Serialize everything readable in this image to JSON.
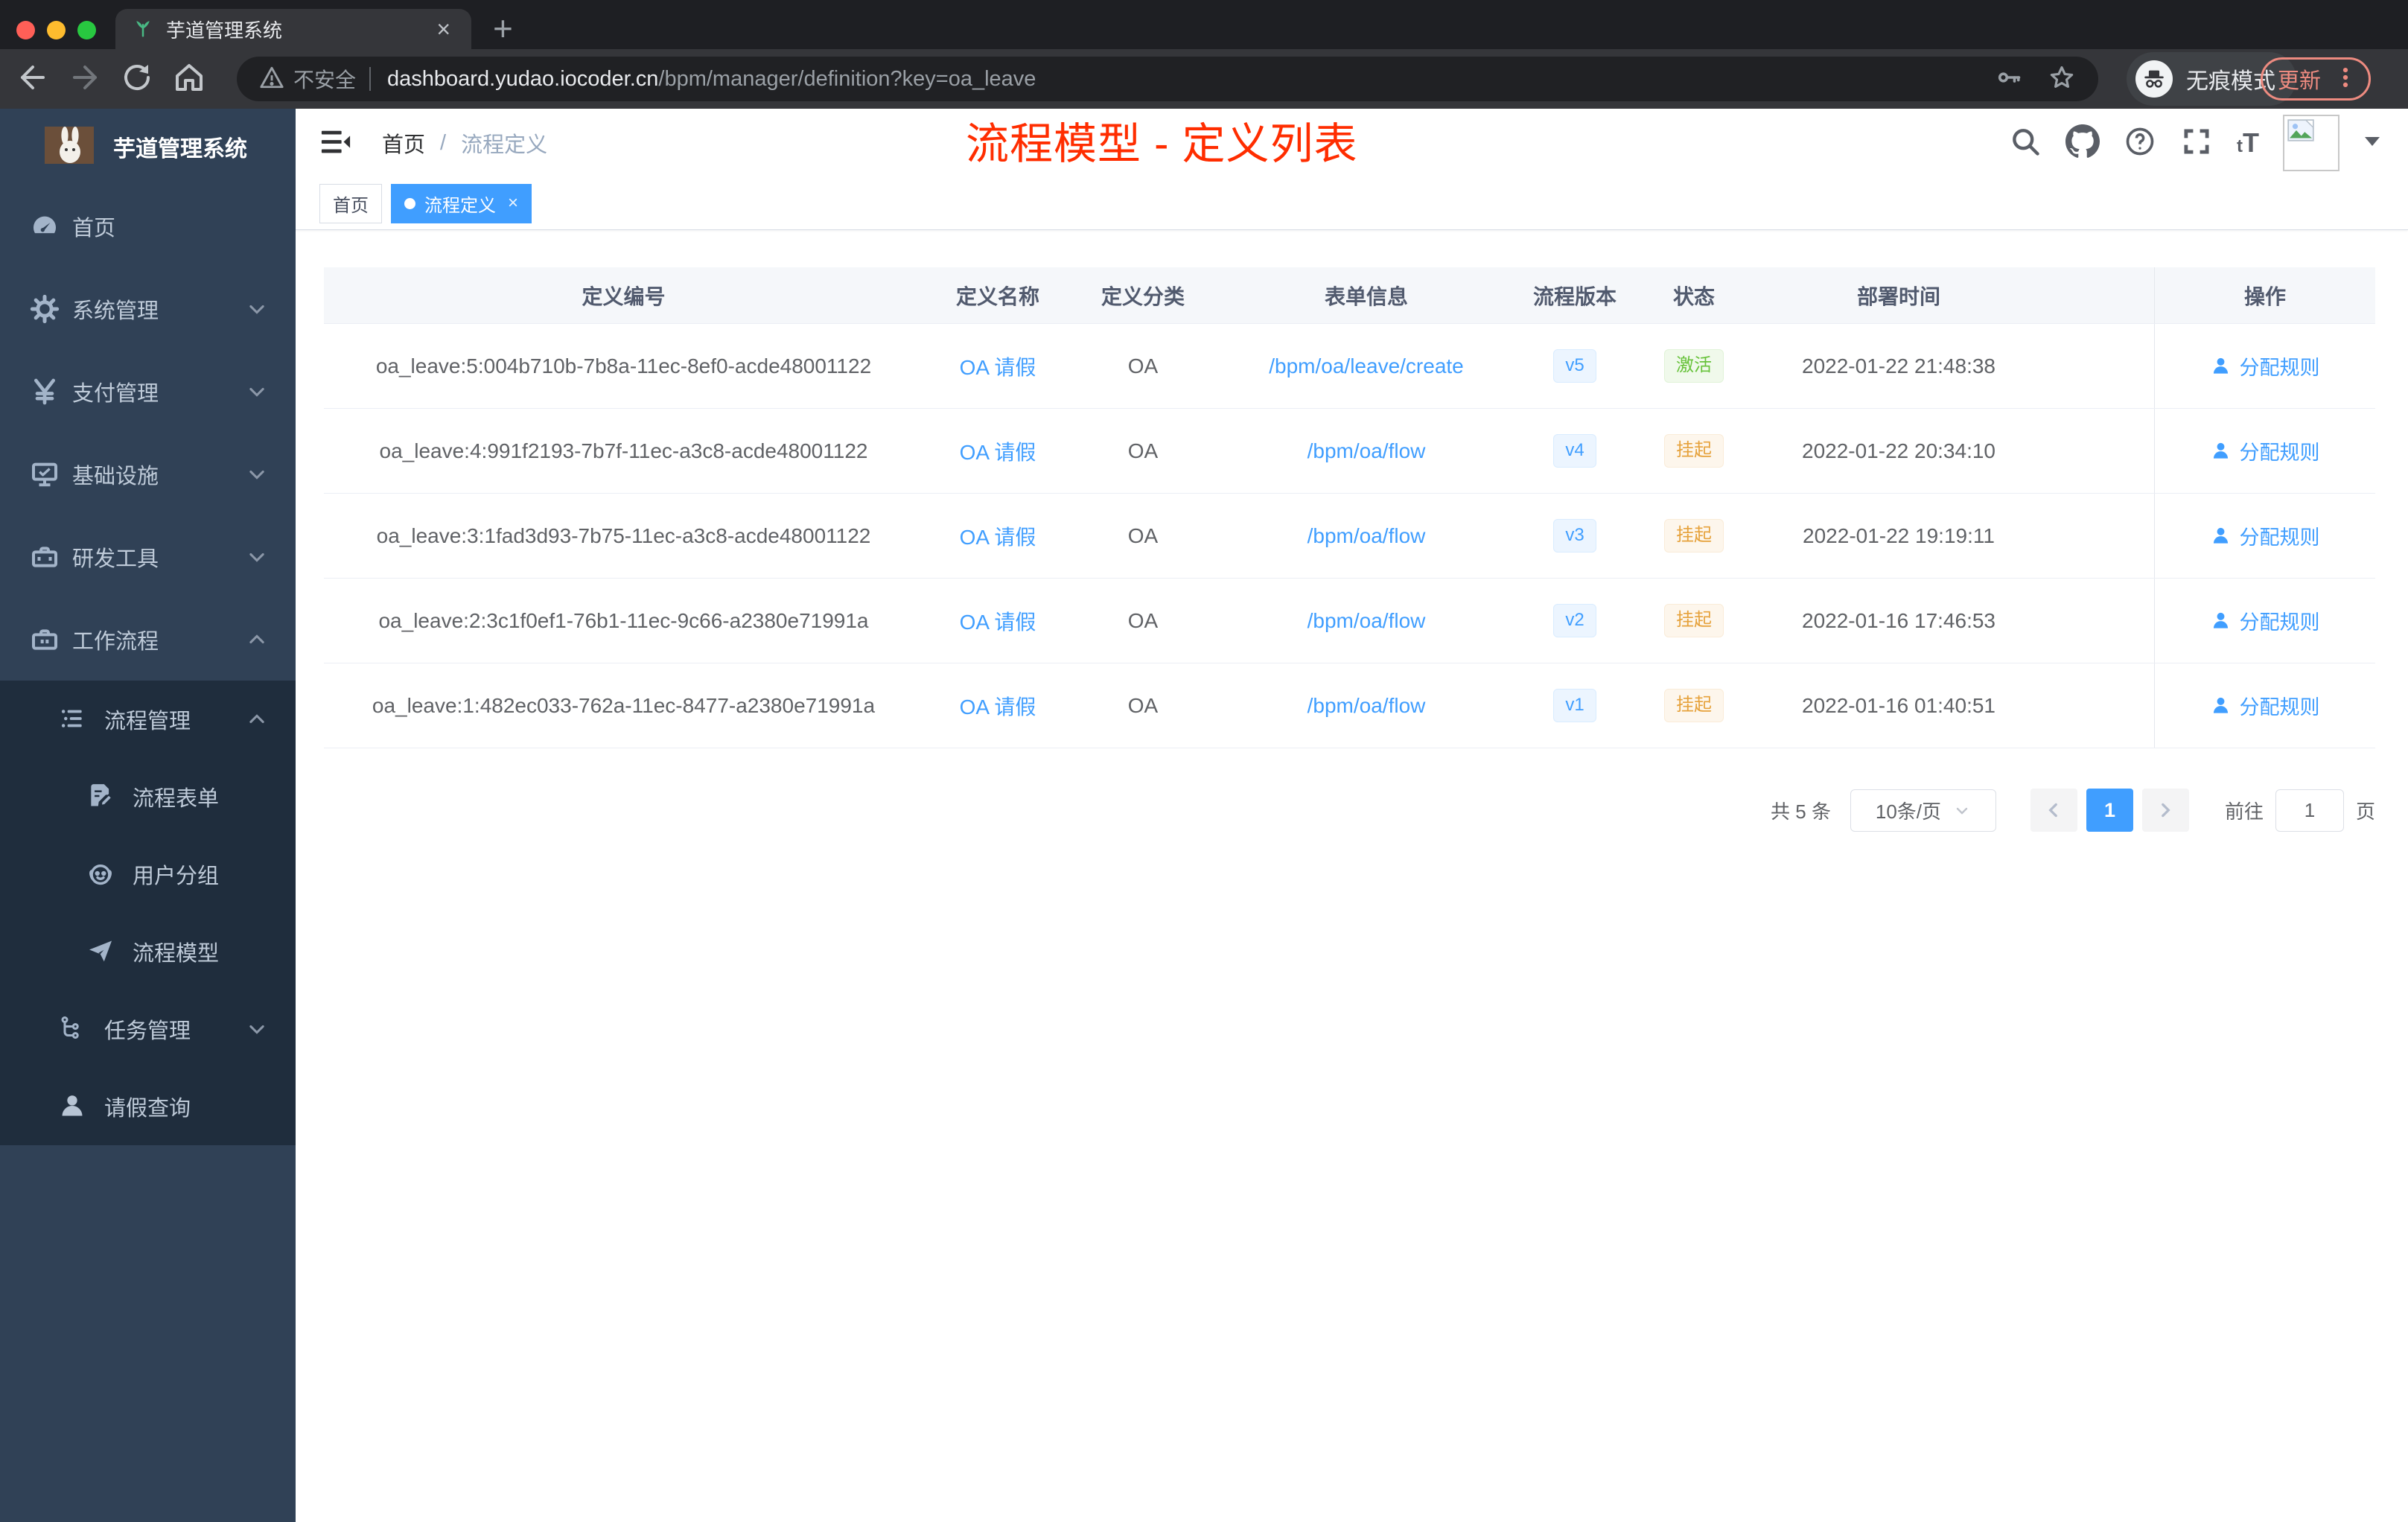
{
  "browser": {
    "tab_title": "芋道管理系统",
    "security_label": "不安全",
    "url_host": "dashboard.yudao.iocoder.cn",
    "url_path": "/bpm/manager/definition?key=oa_leave",
    "incognito_label": "无痕模式",
    "update_label": "更新"
  },
  "sidebar": {
    "app_title": "芋道管理系统",
    "items": [
      {
        "label": "首页",
        "icon": "dashboard-icon",
        "level": 0,
        "chevron": null,
        "expanded": false
      },
      {
        "label": "系统管理",
        "icon": "gear-icon",
        "level": 0,
        "chevron": "down",
        "expanded": false
      },
      {
        "label": "支付管理",
        "icon": "yen-icon",
        "level": 0,
        "chevron": "down",
        "expanded": false
      },
      {
        "label": "基础设施",
        "icon": "monitor-icon",
        "level": 0,
        "chevron": "down",
        "expanded": false
      },
      {
        "label": "研发工具",
        "icon": "toolbox-icon",
        "level": 0,
        "chevron": "down",
        "expanded": false
      },
      {
        "label": "工作流程",
        "icon": "briefcase-icon",
        "level": 0,
        "chevron": "up",
        "expanded": true
      },
      {
        "label": "流程管理",
        "icon": "list-icon",
        "level": 1,
        "chevron": "up",
        "expanded": true
      },
      {
        "label": "流程表单",
        "icon": "form-icon",
        "level": 2,
        "chevron": null,
        "expanded": false
      },
      {
        "label": "用户分组",
        "icon": "robot-icon",
        "level": 2,
        "chevron": null,
        "expanded": false
      },
      {
        "label": "流程模型",
        "icon": "send-icon",
        "level": 2,
        "chevron": null,
        "expanded": false
      },
      {
        "label": "任务管理",
        "icon": "tree-icon",
        "level": 1,
        "chevron": "down",
        "expanded": false
      },
      {
        "label": "请假查询",
        "icon": "user-icon",
        "level": 1,
        "chevron": null,
        "expanded": false
      }
    ]
  },
  "navbar": {
    "breadcrumb_home": "首页",
    "breadcrumb_sep": "/",
    "breadcrumb_current": "流程定义",
    "fontsize_small": "t",
    "fontsize_big": "T"
  },
  "annotation": {
    "text": "流程模型 - 定义列表",
    "color": "#ff2d00"
  },
  "tags": {
    "items": [
      {
        "label": "首页",
        "active": false
      },
      {
        "label": "流程定义",
        "active": true,
        "close": "×"
      }
    ]
  },
  "table": {
    "columns": [
      "定义编号",
      "定义名称",
      "定义分类",
      "表单信息",
      "流程版本",
      "状态",
      "部署时间",
      "操作"
    ],
    "rows": [
      {
        "id": "oa_leave:5:004b710b-7b8a-11ec-8ef0-acde48001122",
        "name": "OA 请假",
        "category": "OA",
        "form": "/bpm/oa/leave/create",
        "version": "v5",
        "status": "激活",
        "status_type": "success",
        "time": "2022-01-22 21:48:38",
        "action": "分配规则"
      },
      {
        "id": "oa_leave:4:991f2193-7b7f-11ec-a3c8-acde48001122",
        "name": "OA 请假",
        "category": "OA",
        "form": "/bpm/oa/flow",
        "version": "v4",
        "status": "挂起",
        "status_type": "warning",
        "time": "2022-01-22 20:34:10",
        "action": "分配规则"
      },
      {
        "id": "oa_leave:3:1fad3d93-7b75-11ec-a3c8-acde48001122",
        "name": "OA 请假",
        "category": "OA",
        "form": "/bpm/oa/flow",
        "version": "v3",
        "status": "挂起",
        "status_type": "warning",
        "time": "2022-01-22 19:19:11",
        "action": "分配规则"
      },
      {
        "id": "oa_leave:2:3c1f0ef1-76b1-11ec-9c66-a2380e71991a",
        "name": "OA 请假",
        "category": "OA",
        "form": "/bpm/oa/flow",
        "version": "v2",
        "status": "挂起",
        "status_type": "warning",
        "time": "2022-01-16 17:46:53",
        "action": "分配规则"
      },
      {
        "id": "oa_leave:1:482ec033-762a-11ec-8477-a2380e71991a",
        "name": "OA 请假",
        "category": "OA",
        "form": "/bpm/oa/flow",
        "version": "v1",
        "status": "挂起",
        "status_type": "warning",
        "time": "2022-01-16 01:40:51",
        "action": "分配规则"
      }
    ]
  },
  "pagination": {
    "total": "共 5 条",
    "page_size": "10条/页",
    "current_page": "1",
    "goto_label": "前往",
    "goto_value": "1",
    "unit_label": "页"
  },
  "icons": {
    "browser": [
      "back-icon",
      "forward-icon",
      "reload-icon",
      "home-icon",
      "warning-icon",
      "key-icon",
      "star-icon",
      "incognito-icon",
      "kebab-menu-icon",
      "plant-favicon",
      "close-icon",
      "new-tab-icon"
    ],
    "sidebar": [
      "dashboard-icon",
      "gear-icon",
      "yen-icon",
      "monitor-icon",
      "toolbox-icon",
      "briefcase-icon",
      "list-icon",
      "form-icon",
      "robot-icon",
      "send-icon",
      "tree-icon",
      "user-icon"
    ],
    "navbar": [
      "fold-icon",
      "search-icon",
      "github-icon",
      "help-icon",
      "fullscreen-icon",
      "fontsize-icon",
      "broken-image-icon",
      "caret-down-icon"
    ],
    "table": [
      "assign-user-icon"
    ]
  },
  "colors": {
    "accent": "#409eff",
    "success": "#67c23a",
    "warning": "#e6a23c",
    "annotation_red": "#ff2d00",
    "sidebar_bg": "#304156",
    "submenu_bg": "#1f2d3d",
    "chrome_dark": "#1e1f23",
    "toolbar_dark": "#35363a",
    "update_red": "#ee8b80"
  }
}
